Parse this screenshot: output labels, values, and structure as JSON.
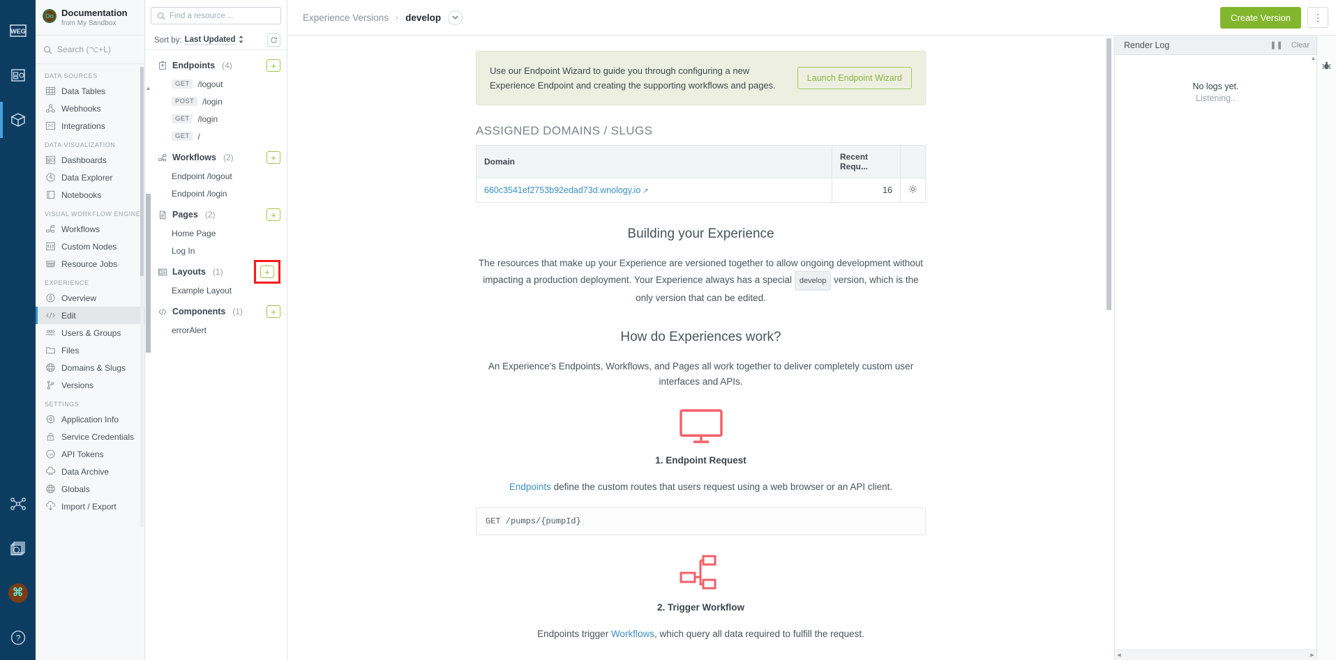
{
  "rail": {
    "items": [
      {
        "name": "weg-logo",
        "label": "WEG"
      },
      {
        "name": "dashboard-icon",
        "label": "Dashboard"
      },
      {
        "name": "application-icon",
        "label": "Application"
      },
      {
        "name": "workflow-icon",
        "label": "Workflows"
      },
      {
        "name": "stack-icon",
        "label": "Stack"
      },
      {
        "name": "user-avatar",
        "label": "Account"
      },
      {
        "name": "help-icon",
        "label": "Help"
      }
    ]
  },
  "nav": {
    "app_title": "Documentation",
    "app_subtitle": "from My Sandbox",
    "logo_text": "Do",
    "search_placeholder": "Search (⌥+L)",
    "sections": [
      {
        "label": "DATA SOURCES",
        "items": [
          {
            "label": "Data Tables",
            "icon": "table-icon",
            "active": false
          },
          {
            "label": "Webhooks",
            "icon": "webhook-icon",
            "active": false
          },
          {
            "label": "Integrations",
            "icon": "integrations-icon",
            "active": false
          }
        ]
      },
      {
        "label": "DATA VISUALIZATION",
        "items": [
          {
            "label": "Dashboards",
            "icon": "dashboard-icon",
            "active": false
          },
          {
            "label": "Data Explorer",
            "icon": "explorer-icon",
            "active": false
          },
          {
            "label": "Notebooks",
            "icon": "notebook-icon",
            "active": false
          }
        ]
      },
      {
        "label": "VISUAL WORKFLOW ENGINE",
        "items": [
          {
            "label": "Workflows",
            "icon": "workflow-icon",
            "active": false
          },
          {
            "label": "Custom Nodes",
            "icon": "custom-node-icon",
            "active": false
          },
          {
            "label": "Resource Jobs",
            "icon": "resource-job-icon",
            "active": false
          }
        ]
      },
      {
        "label": "EXPERIENCE",
        "items": [
          {
            "label": "Overview",
            "icon": "overview-icon",
            "active": false
          },
          {
            "label": "Edit",
            "icon": "edit-icon",
            "active": true
          },
          {
            "label": "Users & Groups",
            "icon": "users-icon",
            "active": false
          },
          {
            "label": "Files",
            "icon": "folder-icon",
            "active": false
          },
          {
            "label": "Domains & Slugs",
            "icon": "globe-icon",
            "active": false
          },
          {
            "label": "Versions",
            "icon": "branch-icon",
            "active": false
          }
        ]
      },
      {
        "label": "SETTINGS",
        "items": [
          {
            "label": "Application Info",
            "icon": "gear-icon",
            "active": false
          },
          {
            "label": "Service Credentials",
            "icon": "lock-icon",
            "active": false
          },
          {
            "label": "API Tokens",
            "icon": "api-icon",
            "active": false
          },
          {
            "label": "Data Archive",
            "icon": "archive-icon",
            "active": false
          },
          {
            "label": "Globals",
            "icon": "globe-icon",
            "active": false
          },
          {
            "label": "Import / Export",
            "icon": "import-export-icon",
            "active": false
          }
        ]
      }
    ]
  },
  "resources": {
    "search_placeholder": "Find a resource ...",
    "sort_label": "Sort by:",
    "sort_value": "Last Updated",
    "groups": [
      {
        "name": "Endpoints",
        "count": "(4)",
        "icon": "endpoint-icon",
        "add_label": "+",
        "highlighted": false,
        "items": [
          {
            "verb": "GET",
            "label": "/logout"
          },
          {
            "verb": "POST",
            "label": "/login"
          },
          {
            "verb": "GET",
            "label": "/login"
          },
          {
            "verb": "GET",
            "label": "/"
          }
        ]
      },
      {
        "name": "Workflows",
        "count": "(2)",
        "icon": "workflow-icon",
        "add_label": "+",
        "highlighted": false,
        "items": [
          {
            "verb": "",
            "label": "Endpoint /logout"
          },
          {
            "verb": "",
            "label": "Endpoint /login"
          }
        ]
      },
      {
        "name": "Pages",
        "count": "(2)",
        "icon": "page-icon",
        "add_label": "+",
        "highlighted": false,
        "items": [
          {
            "verb": "",
            "label": "Home Page"
          },
          {
            "verb": "",
            "label": "Log In"
          }
        ]
      },
      {
        "name": "Layouts",
        "count": "(1)",
        "icon": "layout-icon",
        "add_label": "+",
        "highlighted": true,
        "items": [
          {
            "verb": "",
            "label": "Example Layout"
          }
        ]
      },
      {
        "name": "Components",
        "count": "(1)",
        "icon": "component-icon",
        "add_label": "+",
        "highlighted": false,
        "items": [
          {
            "verb": "",
            "label": "errorAlert"
          }
        ]
      }
    ]
  },
  "topbar": {
    "breadcrumb_parent": "Experience Versions",
    "breadcrumb_sep": "›",
    "breadcrumb_current": "develop",
    "create_version_label": "Create Version",
    "kebab_label": "⋮"
  },
  "doc": {
    "alert_text": "Use our Endpoint Wizard to guide you through configuring a new Experience Endpoint and creating the supporting workflows and pages.",
    "alert_button": "Launch Endpoint Wizard",
    "domains_title": "ASSIGNED DOMAINS / SLUGS",
    "domains_table": {
      "headers": [
        "Domain",
        "Recent Requ...",
        ""
      ],
      "rows": [
        {
          "domain": "660c3541ef2753b92edad73d.wnology.io",
          "requests": "16"
        }
      ]
    },
    "building_title": "Building your Experience",
    "building_p1_a": "The resources that make up your Experience are versioned together to allow ongoing development without impacting a production deployment. Your Experience always has a special",
    "building_chip": "develop",
    "building_p1_b": "version, which is the only version that can be edited.",
    "how_title": "How do Experiences work?",
    "how_p": "An Experience's Endpoints, Workflows, and Pages all work together to deliver completely custom user interfaces and APIs.",
    "step1_title": "1. Endpoint Request",
    "step1_link": "Endpoints",
    "step1_rest": " define the custom routes that users request using a web browser or an API client.",
    "step1_code": "GET /pumps/{pumpId}",
    "step2_title": "2. Trigger Workflow",
    "step2_a": "Endpoints trigger ",
    "step2_link": "Workflows",
    "step2_b": ", which query all data required to fulfill the request."
  },
  "render_log": {
    "title": "Render Log",
    "pause_label": "❚❚",
    "clear_label": "Clear",
    "empty_line1": "No logs yet.",
    "empty_line2": "Listening.."
  },
  "colors": {
    "rail_bg": "#0d3c61",
    "accent_green": "#82b62c",
    "highlight_red": "#f91b1b",
    "link_blue": "#3b8fc4",
    "alert_bg": "#edf0e1"
  }
}
